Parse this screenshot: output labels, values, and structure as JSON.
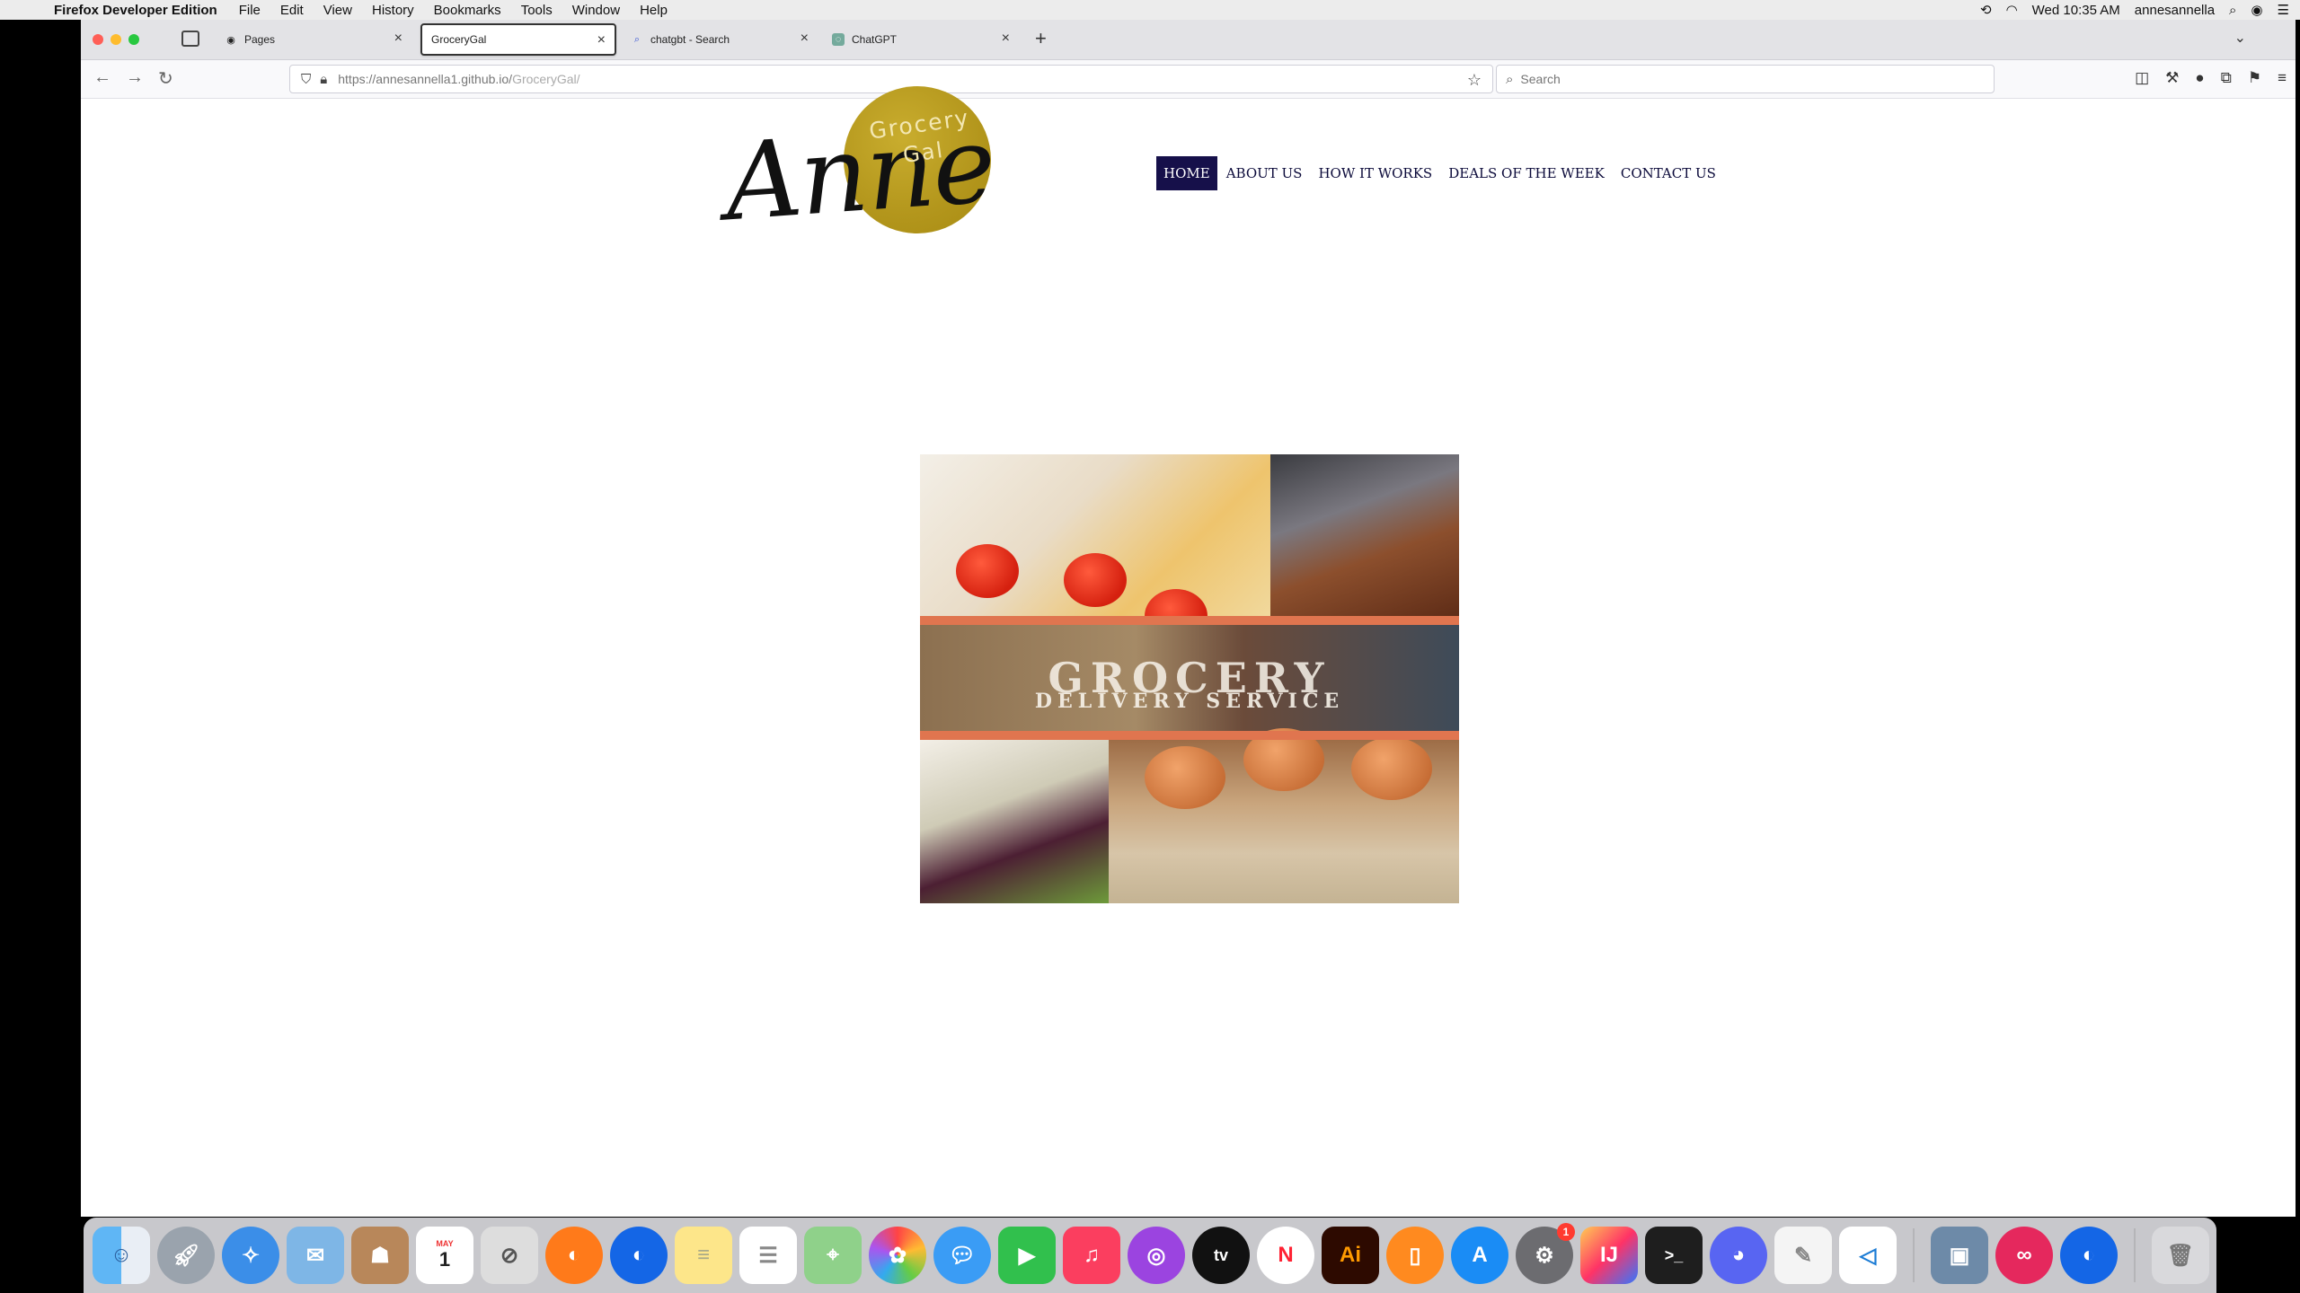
{
  "menubar": {
    "app_name": "Firefox Developer Edition",
    "menus": [
      "File",
      "Edit",
      "View",
      "History",
      "Bookmarks",
      "Tools",
      "Window",
      "Help"
    ],
    "clock": "Wed 10:35 AM",
    "user": "annesannella"
  },
  "browser": {
    "tabs": [
      {
        "title": "Pages",
        "icon": "github-icon"
      },
      {
        "title": "GroceryGal",
        "icon": "none"
      },
      {
        "title": "chatgbt - Search",
        "icon": "search-icon"
      },
      {
        "title": "ChatGPT",
        "icon": "chatgpt-icon"
      }
    ],
    "url_host": "https://annesannella1.github.io/",
    "url_path": "GroceryGal/",
    "search_placeholder": "Search"
  },
  "site": {
    "logo": {
      "main": "Anne",
      "line1": "Grocery",
      "line2": "Gal"
    },
    "nav": [
      "HOME",
      "ABOUT US",
      "HOW IT WORKS",
      "DEALS OF THE WEEK",
      "CONTACT US"
    ],
    "hero": {
      "title": "GROCERY",
      "subtitle": "DELIVERY SERVICE"
    },
    "colors": {
      "nav_active_bg": "#16104a",
      "logo_circle": "#b3961c",
      "nav_text": "#0b0a3a"
    }
  },
  "dock": {
    "apps": [
      "Finder",
      "Launchpad",
      "Safari",
      "Mail",
      "Contacts",
      "Calendar",
      "Preview",
      "Firefox",
      "Firefox Developer Edition",
      "Notes",
      "Reminders",
      "Maps",
      "Photos",
      "Messages",
      "FaceTime",
      "Music",
      "Podcasts",
      "TV",
      "News",
      "Illustrator",
      "Books",
      "App Store",
      "System Preferences",
      "IntelliJ IDEA",
      "Terminal",
      "Discord",
      "TextEdit",
      "Visual Studio Code"
    ],
    "calendar": {
      "month": "MAY",
      "day": "1"
    },
    "system_prefs_badge": "1"
  }
}
